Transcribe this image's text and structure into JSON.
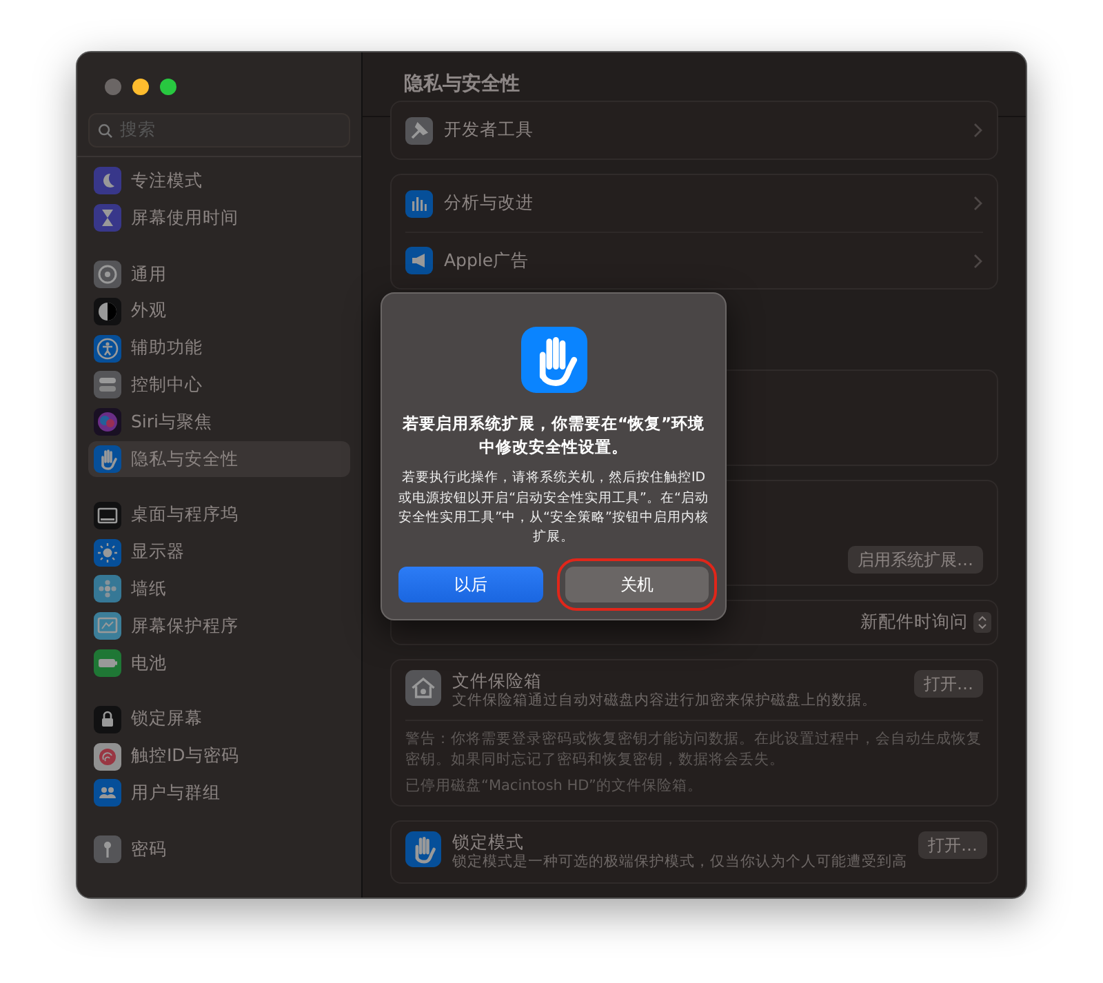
{
  "sidebar": {
    "search": {
      "placeholder": "搜索"
    },
    "groups": [
      {
        "items": [
          {
            "label": "专注模式",
            "kind": "moon",
            "selected": false
          },
          {
            "label": "屏幕使用时间",
            "kind": "hourglass",
            "selected": false
          }
        ]
      },
      {
        "items": [
          {
            "label": "通用",
            "kind": "gear",
            "selected": false
          },
          {
            "label": "外观",
            "kind": "appearance",
            "selected": false
          },
          {
            "label": "辅助功能",
            "kind": "accessibility",
            "selected": false
          },
          {
            "label": "控制中心",
            "kind": "toggles",
            "selected": false
          },
          {
            "label": "Siri与聚焦",
            "kind": "siri",
            "selected": false
          },
          {
            "label": "隐私与安全性",
            "kind": "hand",
            "selected": true
          }
        ]
      },
      {
        "items": [
          {
            "label": "桌面与程序坞",
            "kind": "desktop",
            "selected": false
          },
          {
            "label": "显示器",
            "kind": "sun",
            "selected": false
          },
          {
            "label": "墙纸",
            "kind": "flower",
            "selected": false
          },
          {
            "label": "屏幕保护程序",
            "kind": "screensaver",
            "selected": false
          },
          {
            "label": "电池",
            "kind": "battery",
            "selected": false
          }
        ]
      },
      {
        "items": [
          {
            "label": "锁定屏幕",
            "kind": "lock",
            "selected": false
          },
          {
            "label": "触控ID与密码",
            "kind": "fingerprint",
            "selected": false
          },
          {
            "label": "用户与群组",
            "kind": "users",
            "selected": false
          }
        ]
      },
      {
        "items": [
          {
            "label": "密码",
            "kind": "key",
            "selected": false
          }
        ]
      }
    ]
  },
  "main": {
    "title": "隐私与安全性",
    "sections": [
      {
        "kind": "rows",
        "rows": [
          {
            "label": "开发者工具",
            "kind": "hammer"
          }
        ]
      },
      {
        "kind": "rows",
        "rows": [
          {
            "label": "分析与改进",
            "kind": "chart"
          },
          {
            "label": "Apple广告",
            "kind": "megaphone"
          }
        ]
      },
      {
        "kind": "blank"
      },
      {
        "kind": "button",
        "button": "启用系统扩展…"
      },
      {
        "kind": "popup",
        "value": "新配件时询问"
      },
      {
        "kind": "feature",
        "title": "文件保险箱",
        "description": "文件保险箱通过自动对磁盘内容进行加密来保护磁盘上的数据。",
        "button": "打开…",
        "notes": [
          "警告：你将需要登录密码或恢复密钥才能访问数据。在此设置过程中，会自动生成恢复密钥。如果同时忘记了密码和恢复密钥，数据将会丢失。",
          "已停用磁盘“Macintosh HD”的文件保险箱。"
        ]
      },
      {
        "kind": "feature",
        "title": "锁定模式",
        "description": "锁定模式是一种可选的极端保护模式，仅当你认为个人可能遭受到高",
        "button": "打开…"
      }
    ]
  },
  "dialog": {
    "title": "若要启用系统扩展，你需要在“恢复”环境中修改安全性设置。",
    "message": "若要执行此操作，请将系统关机，然后按住触控ID或电源按钮以开启“启动安全性实用工具”。在“启动安全性实用工具”中，从“安全策略”按钮中启用内核扩展。",
    "buttons": [
      {
        "label": "以后",
        "default": true,
        "highlighted": false
      },
      {
        "label": "关机",
        "default": false,
        "highlighted": true
      }
    ]
  }
}
